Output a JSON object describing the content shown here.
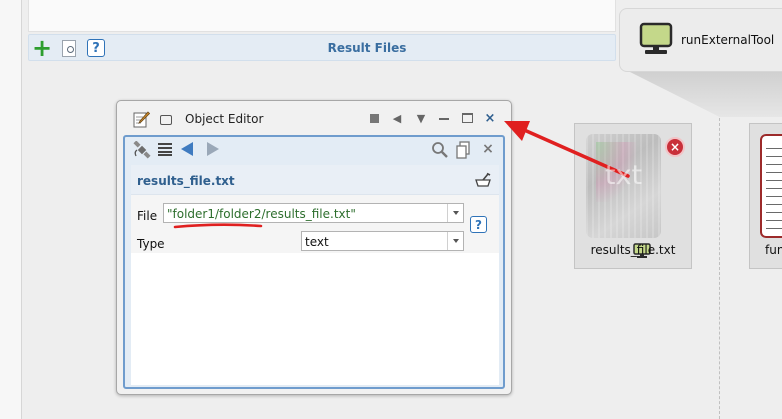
{
  "result_panel": {
    "title": "Result Files",
    "icons": [
      "add-icon",
      "view-document-icon",
      "help-icon"
    ],
    "help_glyph": "?"
  },
  "tool_callout": {
    "label": "runExternalTool",
    "icon": "monitor-icon"
  },
  "file_node": {
    "thumbnail_text": "txt",
    "label": "results_file.txt",
    "remove_glyph": "×"
  },
  "right_node": {
    "label": "fun"
  },
  "object_editor": {
    "title": "Object Editor",
    "window_buttons": {
      "prev_glyph": "◀",
      "down_glyph": "▼",
      "close_glyph": "×"
    },
    "toolbar_close_glyph": "×",
    "form": {
      "title": "results_file.txt",
      "file_label": "File",
      "file_value": "\"folder1/folder2/results_file.txt\"",
      "type_label": "Type",
      "type_value": "text",
      "help_glyph": "?"
    }
  },
  "colors": {
    "accent_blue": "#3a6ea0",
    "annotation_red": "#e02020",
    "file_value_green": "#2d6e2d"
  }
}
